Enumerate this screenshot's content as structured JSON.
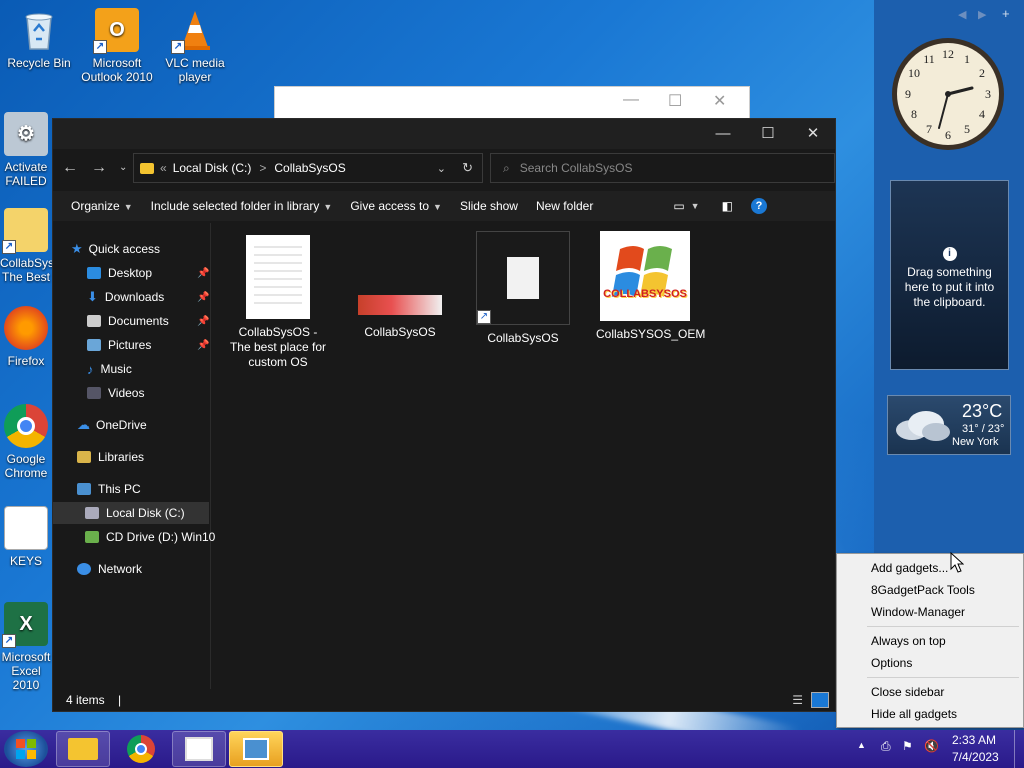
{
  "desktop": {
    "icons": [
      {
        "label": "Recycle Bin"
      },
      {
        "label": "Microsoft Outlook 2010"
      },
      {
        "label": "VLC media player"
      },
      {
        "label": "Activate FAILED"
      },
      {
        "label": "CollabSys The Best"
      },
      {
        "label": "Firefox"
      },
      {
        "label": "Google Chrome"
      },
      {
        "label": "KEYS"
      },
      {
        "label": "Microsoft Excel 2010"
      }
    ]
  },
  "explorer": {
    "address": {
      "breadcrumb_root": "Local Disk (C:)",
      "breadcrumb_sep": ">",
      "breadcrumb_current": "CollabSysOS",
      "overflow": "«"
    },
    "search": {
      "placeholder": "Search CollabSysOS"
    },
    "toolbar": {
      "organize": "Organize",
      "include_library": "Include selected folder in library",
      "give_access": "Give access to",
      "slide_show": "Slide show",
      "new_folder": "New folder"
    },
    "nav": {
      "quick_access": "Quick access",
      "desktop": "Desktop",
      "downloads": "Downloads",
      "documents": "Documents",
      "pictures": "Pictures",
      "music": "Music",
      "videos": "Videos",
      "onedrive": "OneDrive",
      "libraries": "Libraries",
      "this_pc": "This PC",
      "local_disk": "Local Disk (C:)",
      "cd_drive": "CD Drive (D:) Win10",
      "network": "Network"
    },
    "files": [
      {
        "name": "CollabSysOS - The best place for custom OS"
      },
      {
        "name": "CollabSysOS"
      },
      {
        "name": "CollabSysOS"
      },
      {
        "name": "CollabSYSOS_OEM"
      }
    ],
    "logo_text": "COLLABSYSOS",
    "status": {
      "count": "4 items",
      "sep": "|"
    }
  },
  "sidebar": {
    "clipboard_text": "Drag something here to put it into the clipboard.",
    "weather": {
      "temp": "23°C",
      "range": "31° / 23°",
      "city": "New York"
    }
  },
  "context_menu": {
    "items": [
      "Add gadgets...",
      "8GadgetPack Tools",
      "Window-Manager",
      "Always on top",
      "Options",
      "Close sidebar",
      "Hide all gadgets"
    ]
  },
  "taskbar": {
    "time": "2:33 AM",
    "date": "7/4/2023"
  }
}
